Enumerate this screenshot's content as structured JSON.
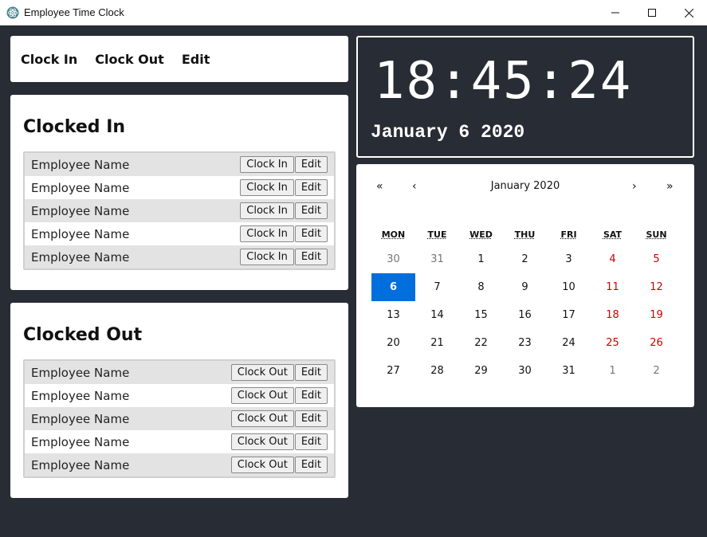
{
  "window": {
    "title": "Employee Time Clock",
    "icon": "electron-atom-icon",
    "controls": [
      "minimize-icon",
      "maximize-icon",
      "close-icon"
    ]
  },
  "menu": {
    "clock_in": "Clock In",
    "clock_out": "Clock Out",
    "edit": "Edit"
  },
  "clocked_in": {
    "heading": "Clocked In",
    "rows": [
      {
        "name": "Employee Name",
        "action": "Clock In",
        "edit": "Edit"
      },
      {
        "name": "Employee Name",
        "action": "Clock In",
        "edit": "Edit"
      },
      {
        "name": "Employee Name",
        "action": "Clock In",
        "edit": "Edit"
      },
      {
        "name": "Employee Name",
        "action": "Clock In",
        "edit": "Edit"
      },
      {
        "name": "Employee Name",
        "action": "Clock In",
        "edit": "Edit"
      }
    ]
  },
  "clocked_out": {
    "heading": "Clocked Out",
    "rows": [
      {
        "name": "Employee Name",
        "action": "Clock Out",
        "edit": "Edit"
      },
      {
        "name": "Employee Name",
        "action": "Clock Out",
        "edit": "Edit"
      },
      {
        "name": "Employee Name",
        "action": "Clock Out",
        "edit": "Edit"
      },
      {
        "name": "Employee Name",
        "action": "Clock Out",
        "edit": "Edit"
      },
      {
        "name": "Employee Name",
        "action": "Clock Out",
        "edit": "Edit"
      }
    ]
  },
  "clock": {
    "time": "18:45:24",
    "date": "January 6 2020"
  },
  "calendar": {
    "prev_year": "«",
    "prev_month": "‹",
    "month_label": "January 2020",
    "next_month": "›",
    "next_year": "»",
    "weekdays": [
      "MON",
      "TUE",
      "WED",
      "THU",
      "FRI",
      "SAT",
      "SUN"
    ],
    "weeks": [
      [
        "30",
        "31",
        "1",
        "2",
        "3",
        "4",
        "5"
      ],
      [
        "6",
        "7",
        "8",
        "9",
        "10",
        "11",
        "12"
      ],
      [
        "13",
        "14",
        "15",
        "16",
        "17",
        "18",
        "19"
      ],
      [
        "20",
        "21",
        "22",
        "23",
        "24",
        "25",
        "26"
      ],
      [
        "27",
        "28",
        "29",
        "30",
        "31",
        "1",
        "2"
      ]
    ],
    "selected_day": "6",
    "colors": {
      "selected": "#006edc",
      "weekend": "#d10000",
      "neighbor_month": "#757575"
    }
  }
}
